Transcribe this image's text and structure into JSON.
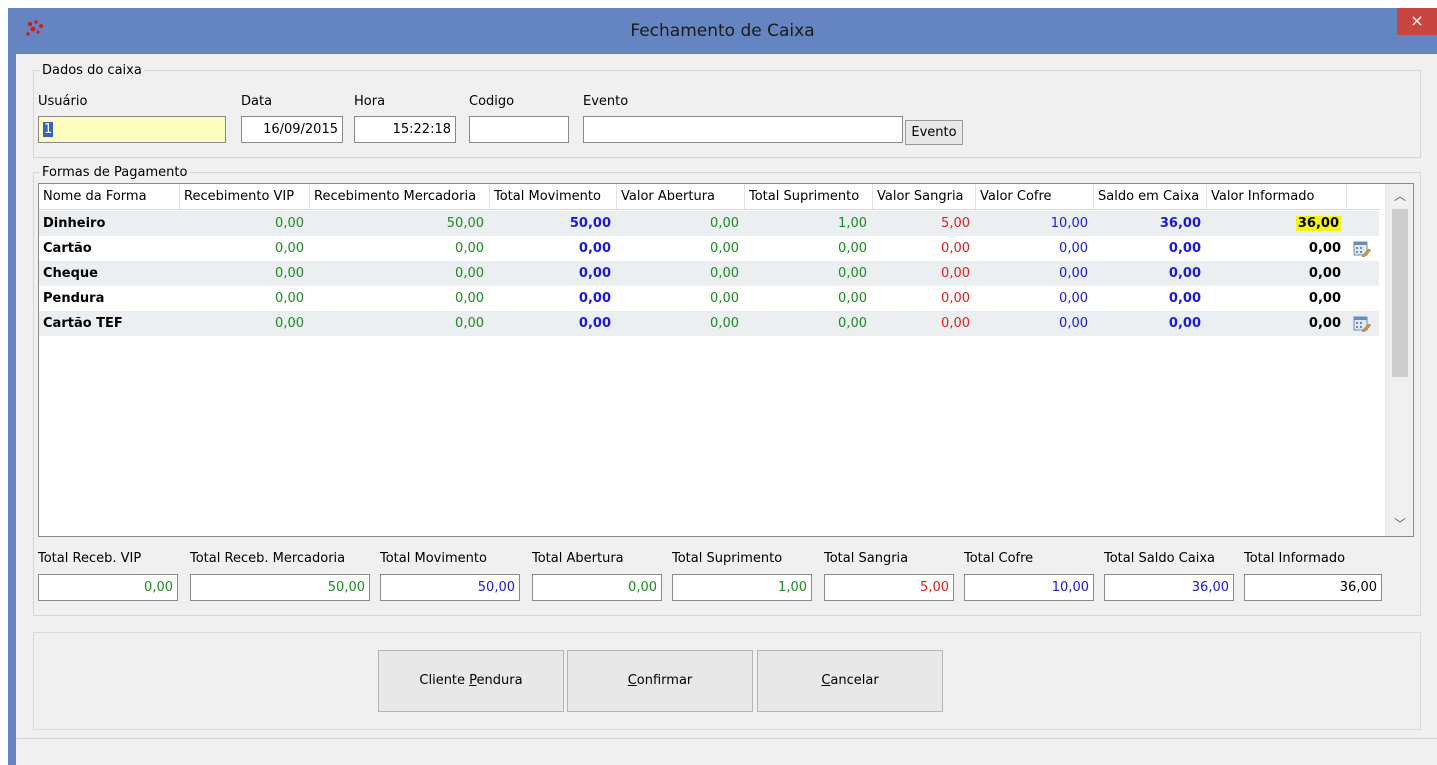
{
  "window": {
    "title": "Fechamento de Caixa",
    "close_label": "×"
  },
  "dados": {
    "group_title": "Dados do caixa",
    "usuario_label": "Usuário",
    "usuario_value": "1",
    "data_label": "Data",
    "data_value": "16/09/2015",
    "hora_label": "Hora",
    "hora_value": "15:22:18",
    "codigo_label": "Codigo",
    "codigo_value": "",
    "evento_label": "Evento",
    "evento_value": "",
    "evento_button": "Evento"
  },
  "formas": {
    "group_title": "Formas de Pagamento",
    "columns": [
      "Nome da Forma",
      "Recebimento VIP",
      "Recebimento Mercadoria",
      "Total Movimento",
      "Valor Abertura",
      "Total Suprimento",
      "Valor Sangria",
      "Valor Cofre",
      "Saldo em Caixa",
      "Valor Informado"
    ],
    "rows": [
      {
        "nome": "Dinheiro",
        "vip": "0,00",
        "mercadoria": "50,00",
        "movimento": "50,00",
        "abertura": "0,00",
        "suprimento": "1,00",
        "sangria": "5,00",
        "cofre": "10,00",
        "saldo": "36,00",
        "informado": "36,00"
      },
      {
        "nome": "Cartão",
        "vip": "0,00",
        "mercadoria": "0,00",
        "movimento": "0,00",
        "abertura": "0,00",
        "suprimento": "0,00",
        "sangria": "0,00",
        "cofre": "0,00",
        "saldo": "0,00",
        "informado": "0,00"
      },
      {
        "nome": "Cheque",
        "vip": "0,00",
        "mercadoria": "0,00",
        "movimento": "0,00",
        "abertura": "0,00",
        "suprimento": "0,00",
        "sangria": "0,00",
        "cofre": "0,00",
        "saldo": "0,00",
        "informado": "0,00"
      },
      {
        "nome": "Pendura",
        "vip": "0,00",
        "mercadoria": "0,00",
        "movimento": "0,00",
        "abertura": "0,00",
        "suprimento": "0,00",
        "sangria": "0,00",
        "cofre": "0,00",
        "saldo": "0,00",
        "informado": "0,00"
      },
      {
        "nome": "Cartão TEF",
        "vip": "0,00",
        "mercadoria": "0,00",
        "movimento": "0,00",
        "abertura": "0,00",
        "suprimento": "0,00",
        "sangria": "0,00",
        "cofre": "0,00",
        "saldo": "0,00",
        "informado": "0,00"
      }
    ]
  },
  "totals": {
    "vip_label": "Total Receb. VIP",
    "vip_value": "0,00",
    "mercadoria_label": "Total Receb. Mercadoria",
    "mercadoria_value": "50,00",
    "movimento_label": "Total Movimento",
    "movimento_value": "50,00",
    "abertura_label": "Total Abertura",
    "abertura_value": "0,00",
    "suprimento_label": "Total Suprimento",
    "suprimento_value": "1,00",
    "sangria_label": "Total Sangria",
    "sangria_value": "5,00",
    "cofre_label": "Total Cofre",
    "cofre_value": "10,00",
    "saldo_label": "Total Saldo Caixa",
    "saldo_value": "36,00",
    "informado_label": "Total Informado",
    "informado_value": "36,00"
  },
  "actions": {
    "cliente_pendura": {
      "before": "Cliente ",
      "mnemonic": "P",
      "after": "endura"
    },
    "confirmar": {
      "before": "",
      "mnemonic": "C",
      "after": "onfirmar"
    },
    "cancelar": {
      "before": "",
      "mnemonic": "C",
      "after": "ancelar"
    }
  },
  "colors": {
    "titlebar": "#6585c2",
    "close": "#c7463f",
    "highlight": "#f4f21a",
    "green": "#1e8b1e",
    "red": "#e02020",
    "blue": "#1a1ad6"
  }
}
